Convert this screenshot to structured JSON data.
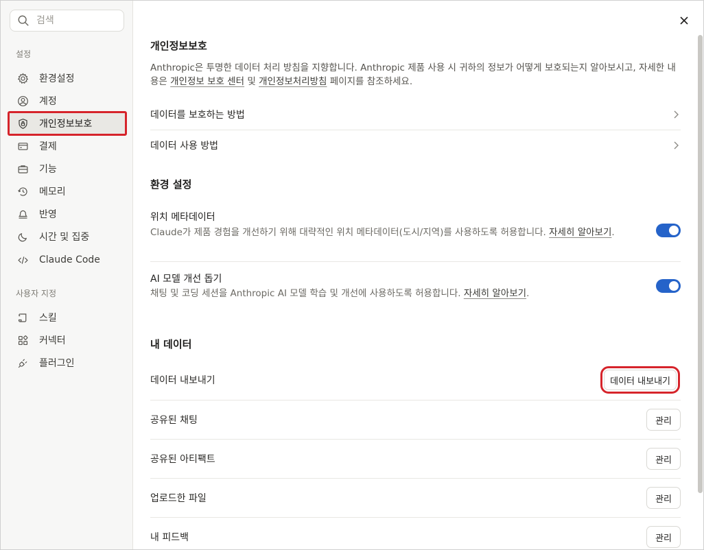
{
  "search": {
    "placeholder": "검색"
  },
  "sidebar": {
    "section1": "설정",
    "items": [
      {
        "label": "환경설정",
        "icon": "gear-icon"
      },
      {
        "label": "계정",
        "icon": "user-circle-icon"
      },
      {
        "label": "개인정보보호",
        "icon": "shield-lock-icon",
        "active": true
      },
      {
        "label": "결제",
        "icon": "credit-card-icon"
      },
      {
        "label": "기능",
        "icon": "briefcase-icon"
      },
      {
        "label": "메모리",
        "icon": "history-icon"
      },
      {
        "label": "반영",
        "icon": "bell-icon"
      },
      {
        "label": "시간 및 집중",
        "icon": "moon-icon"
      },
      {
        "label": "Claude Code",
        "icon": "code-icon"
      }
    ],
    "section2": "사용자 지정",
    "custom_items": [
      {
        "label": "스킬",
        "icon": "scroll-icon"
      },
      {
        "label": "커넥터",
        "icon": "connector-icon"
      },
      {
        "label": "플러그인",
        "icon": "plug-icon"
      }
    ]
  },
  "privacy": {
    "title": "개인정보보호",
    "desc_part1": "Anthropic은 투명한 데이터 처리 방침을 지향합니다. Anthropic 제품 사용 시 귀하의 정보가 어떻게 보호되는지 알아보시고, 자세한 내용은 ",
    "link1": "개인정보 보호 센터",
    "desc_part2": " 및 ",
    "link2": "개인정보처리방침",
    "desc_part3": " 페이지를 참조하세요.",
    "rows": [
      {
        "label": "데이터를 보호하는 방법"
      },
      {
        "label": "데이터 사용 방법"
      }
    ]
  },
  "env": {
    "title": "환경 설정",
    "location": {
      "title": "위치 메타데이터",
      "desc": "Claude가 제품 경험을 개선하기 위해 대략적인 위치 메타데이터(도시/지역)를 사용하도록 허용합니다. ",
      "link": "자세히 알아보기",
      "suffix": ".",
      "enabled": true
    },
    "ai_model": {
      "title": "AI 모델 개선 돕기",
      "desc": "채팅 및 코딩 세션을 Anthropic AI 모델 학습 및 개선에 사용하도록 허용합니다. ",
      "link": "자세히 알아보기",
      "suffix": ".",
      "enabled": true
    }
  },
  "my_data": {
    "title": "내 데이터",
    "export": {
      "label": "데이터 내보내기",
      "button": "데이터 내보내기"
    },
    "rows": [
      {
        "label": "공유된 채팅",
        "button": "관리"
      },
      {
        "label": "공유된 아티팩트",
        "button": "관리"
      },
      {
        "label": "업로드한 파일",
        "button": "관리"
      },
      {
        "label": "내 피드백",
        "button": "관리"
      }
    ]
  },
  "colors": {
    "accent_toggle": "#2563c9",
    "highlight": "#d6242b"
  }
}
